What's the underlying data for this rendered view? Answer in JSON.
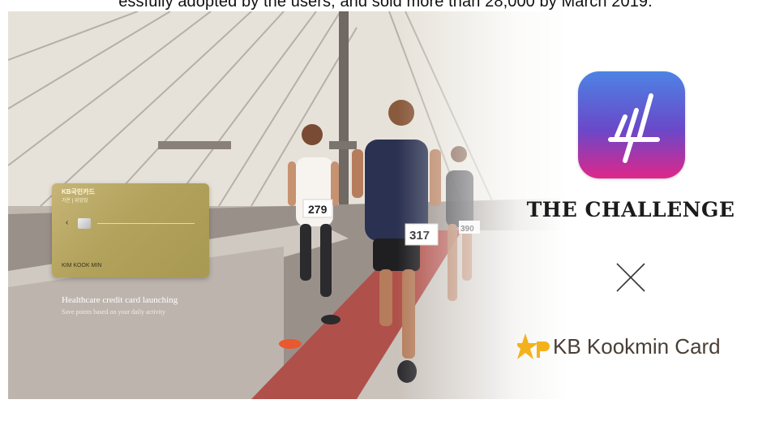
{
  "top_caption": "essfully adopted by the users, and sold more than 28,000 by March 2019.",
  "card": {
    "brand": "KB국민카드",
    "subtitle": "가온 | 위잉잉",
    "holder_name": "KIM KOOK MIN"
  },
  "promo": {
    "title": "Healthcare credit card launching",
    "subtitle": "Save points based on your daily activity"
  },
  "runners": {
    "bib_left": "279",
    "bib_center": "317",
    "bib_right": "390"
  },
  "partners": {
    "app_name": "THE CHALLENGE",
    "card_company": "KB Kookmin Card"
  },
  "colors": {
    "app_gradient_top": "#4d83e4",
    "app_gradient_bottom": "#e0268a",
    "kb_yellow": "#f3b21c",
    "kb_text": "#4a3f35"
  }
}
